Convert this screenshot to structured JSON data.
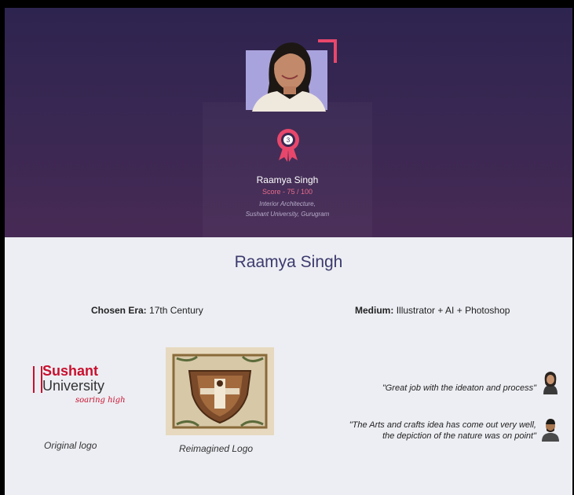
{
  "profile": {
    "hero_name": "Raamya Singh",
    "score": "Score - 75 / 100",
    "department": "Interior Architecture,",
    "university": "Sushant University, Gurugram",
    "badge_rank": "3",
    "badge_icon": "rosette-badge-icon",
    "photo": "student-portrait"
  },
  "details": {
    "name": "Raamya Singh",
    "era_label": "Chosen Era:",
    "era_value": "17th Century",
    "medium_label": "Medium:",
    "medium_value": "Illustrator + AI + Photoshop"
  },
  "logos": {
    "original_line1": "Sushant",
    "original_line2": "University",
    "original_tagline": "soaring high",
    "original_caption": "Original logo",
    "reimagined_caption": "Reimagined Logo"
  },
  "feedback": [
    {
      "quote": "\"Great job with the ideaton and process\""
    },
    {
      "quote_line1": "\"The Arts and crafts idea has come out very well,",
      "quote_line2": "the depiction of the nature was on point\""
    }
  ],
  "colors": {
    "hero_bg": "#2e2450",
    "accent": "#e8476b",
    "brand_red": "#c8102e",
    "name_color": "#3c3a6e"
  }
}
